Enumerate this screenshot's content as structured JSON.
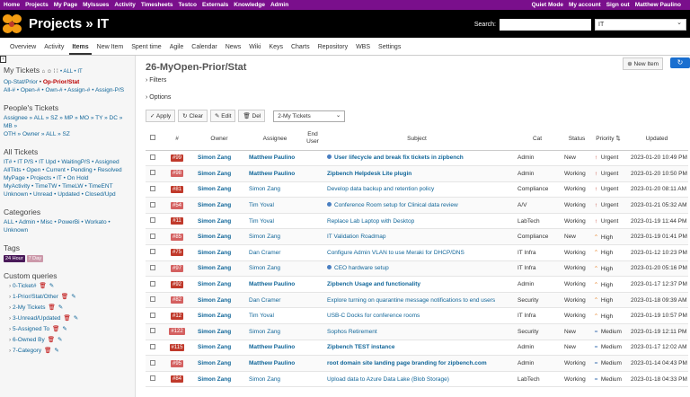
{
  "topmenu": {
    "left": [
      "Home",
      "Projects",
      "My Page",
      "MyIssues",
      "Activity",
      "Timesheets",
      "Testco",
      "Externals",
      "Knowledge",
      "Admin"
    ],
    "right": [
      "Quiet Mode",
      "My account",
      "Sign out",
      "Matthew Paulino"
    ]
  },
  "header": {
    "title": "Projects » IT",
    "search_label": "Search:",
    "project_select": "IT"
  },
  "mainmenu": [
    "Overview",
    "Activity",
    "Items",
    "New Item",
    "Spent time",
    "Agile",
    "Calendar",
    "News",
    "Wiki",
    "Keys",
    "Charts",
    "Repository",
    "WBS",
    "Settings"
  ],
  "sidebar": {
    "my_tickets_title": "My Tickets",
    "my_tickets_icons": "⌂ ☺ ⁞ ⁞",
    "my_tickets_links": "• ALL • IT",
    "row1": "Op-Stat/Prior",
    "row1_sel": "Op-Prior/Stat",
    "row2": "All-# • Open-# • Own-# • Assign-# • Assign-P/S",
    "people_title": "People's Tickets",
    "people_l1": "Assignee » ALL » SZ » MP » MO » TY » DC » MB »",
    "people_l2": "OTH » Owner » ALL » SZ",
    "all_title": "All Tickets",
    "all_l1": "IT# • IT P/S • IT Upd • WaitingP/S • Assigned",
    "all_l2": "AllTkts • Open • Current • Pending • Resolved",
    "all_l3": "MyPage • Projects • IT • On Hold",
    "all_l4": "MyActivity • TimeTW • TimeLW • TimeENT",
    "all_l5": "Unknown • Unread • Updated • Closed/Upd",
    "cat_title": "Categories",
    "cat_l1": "ALL • Admin • Misc • PowerBi • Workato •",
    "cat_l2": "Unknown",
    "tags_title": "Tags",
    "tags": [
      "24 Hour",
      "7 Day"
    ],
    "cq_title": "Custom queries",
    "custom_queries": [
      "0-Ticket#",
      "1-Prior/Stat/Other",
      "2-My Tickets",
      "3-Unread/Updated",
      "5-Assigned To",
      "6-Owned By",
      "7-Category"
    ]
  },
  "content": {
    "title": "26-MyOpen-Prior/Stat",
    "filters": "Filters",
    "options": "Options",
    "new_item": "New Item",
    "actions": {
      "apply": "Apply",
      "clear": "Clear",
      "edit": "Edit",
      "del": "Del",
      "query": "2-My Tickets"
    },
    "columns": [
      "#",
      "Owner",
      "Assignee",
      "End User",
      "Subject",
      "Cat",
      "Status",
      "Priority",
      "Updated"
    ]
  },
  "rows": [
    {
      "id": "#99",
      "owner": "Simon Zang",
      "assignee": "Matthew Paulino",
      "asg_bold": true,
      "dot": true,
      "subject": "User lifecycle and break fix tickets in zipbench",
      "bold": true,
      "cat": "Admin",
      "status": "New",
      "pri": "Urgent",
      "updated": "2023-01-20 10:49 PM"
    },
    {
      "id": "#98",
      "owner": "Simon Zang",
      "assignee": "Matthew Paulino",
      "asg_bold": true,
      "dot": false,
      "subject": "Zipbench Helpdesk Lite plugin",
      "bold": true,
      "cat": "Admin",
      "status": "Working",
      "pri": "Urgent",
      "updated": "2023-01-20 10:50 PM"
    },
    {
      "id": "#81",
      "owner": "Simon Zang",
      "assignee": "Simon Zang",
      "asg_bold": false,
      "dot": false,
      "subject": "Develop data backup and retention policy",
      "bold": false,
      "cat": "Compliance",
      "status": "Working",
      "pri": "Urgent",
      "updated": "2023-01-20 08:11 AM"
    },
    {
      "id": "#54",
      "owner": "Simon Zang",
      "assignee": "Tim Yoval",
      "asg_bold": false,
      "dot": true,
      "subject": "Conference Room setup for Clinical data review",
      "bold": false,
      "cat": "A/V",
      "status": "Working",
      "pri": "Urgent",
      "updated": "2023-01-21 05:32 AM"
    },
    {
      "id": "#11",
      "owner": "Simon Zang",
      "assignee": "Tim Yoval",
      "asg_bold": false,
      "dot": false,
      "subject": "Replace Lab Laptop with Desktop",
      "bold": false,
      "cat": "LabTech",
      "status": "Working",
      "pri": "Urgent",
      "updated": "2023-01-19 11:44 PM"
    },
    {
      "id": "#85",
      "owner": "Simon Zang",
      "assignee": "Simon Zang",
      "asg_bold": false,
      "dot": false,
      "subject": "IT Validation Roadmap",
      "bold": false,
      "cat": "Compliance",
      "status": "New",
      "pri": "High",
      "updated": "2023-01-19 01:41 PM"
    },
    {
      "id": "#75",
      "owner": "Simon Zang",
      "assignee": "Dan Cramer",
      "asg_bold": false,
      "dot": false,
      "subject": "Configure Admin VLAN to use Meraki for DHCP/DNS",
      "bold": false,
      "cat": "IT Infra",
      "status": "Working",
      "pri": "High",
      "updated": "2023-01-12 10:23 PM"
    },
    {
      "id": "#97",
      "owner": "Simon Zang",
      "assignee": "Simon Zang",
      "asg_bold": false,
      "dot": true,
      "subject": "CEO hardware setup",
      "bold": false,
      "cat": "IT Infra",
      "status": "Working",
      "pri": "High",
      "updated": "2023-01-20 05:16 PM"
    },
    {
      "id": "#92",
      "owner": "Simon Zang",
      "assignee": "Matthew Paulino",
      "asg_bold": true,
      "dot": false,
      "subject": "Zipbench Usage and functionality",
      "bold": true,
      "cat": "Admin",
      "status": "Working",
      "pri": "High",
      "updated": "2023-01-17 12:37 PM"
    },
    {
      "id": "#82",
      "owner": "Simon Zang",
      "assignee": "Dan Cramer",
      "asg_bold": false,
      "dot": false,
      "subject": "Explore turning on quarantine message notifications to end users",
      "bold": false,
      "cat": "Security",
      "status": "Working",
      "pri": "High",
      "updated": "2023-01-18 09:39 AM"
    },
    {
      "id": "#12",
      "owner": "Simon Zang",
      "assignee": "Tim Yoval",
      "asg_bold": false,
      "dot": false,
      "subject": "USB-C Docks for conference rooms",
      "bold": false,
      "cat": "IT Infra",
      "status": "Working",
      "pri": "High",
      "updated": "2023-01-19 10:57 PM"
    },
    {
      "id": "#122",
      "owner": "Simon Zang",
      "assignee": "Simon Zang",
      "asg_bold": false,
      "dot": false,
      "subject": "Sophos Retirement",
      "bold": false,
      "cat": "Security",
      "status": "New",
      "pri": "Medium",
      "updated": "2023-01-19 12:11 PM"
    },
    {
      "id": "#115",
      "owner": "Simon Zang",
      "assignee": "Matthew Paulino",
      "asg_bold": true,
      "dot": false,
      "subject": "Zipbench TEST instance",
      "bold": true,
      "cat": "Admin",
      "status": "New",
      "pri": "Medium",
      "updated": "2023-01-17 12:02 AM"
    },
    {
      "id": "#95",
      "owner": "Simon Zang",
      "assignee": "Matthew Paulino",
      "asg_bold": true,
      "dot": false,
      "subject": "root domain site landing page branding for zipbench.com",
      "bold": true,
      "cat": "Admin",
      "status": "Working",
      "pri": "Medium",
      "updated": "2023-01-14 04:43 PM"
    },
    {
      "id": "#84",
      "owner": "Simon Zang",
      "assignee": "Simon Zang",
      "asg_bold": false,
      "dot": false,
      "subject": "Upload data to Azure Data Lake (Blob Storage)",
      "bold": false,
      "cat": "LabTech",
      "status": "Working",
      "pri": "Medium",
      "updated": "2023-01-18 04:33 PM"
    }
  ]
}
